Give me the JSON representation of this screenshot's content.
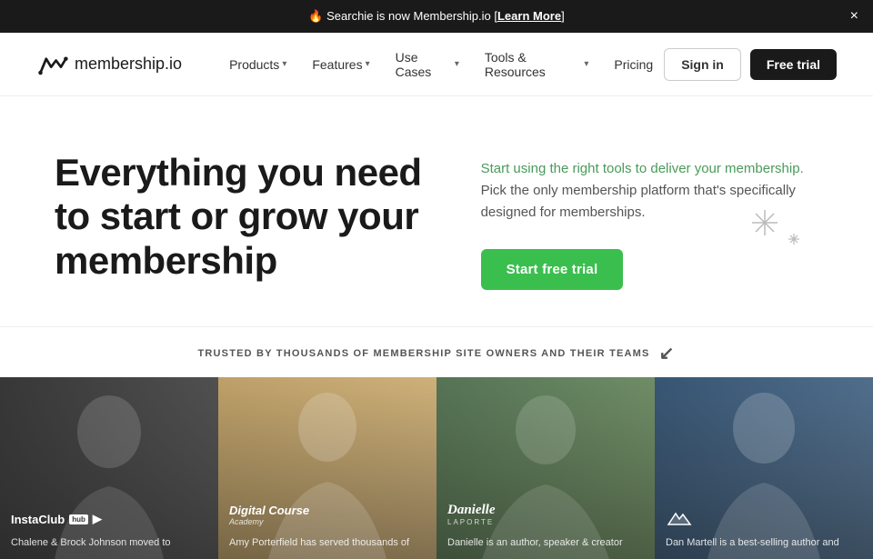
{
  "banner": {
    "text": "🔥 Searchie is now Membership.io [",
    "link_text": "Learn More",
    "text_end": "]",
    "close_label": "×"
  },
  "nav": {
    "logo_text": "membership",
    "logo_suffix": ".io",
    "items": [
      {
        "label": "Products",
        "has_dropdown": true
      },
      {
        "label": "Features",
        "has_dropdown": true
      },
      {
        "label": "Use Cases",
        "has_dropdown": true
      },
      {
        "label": "Tools & Resources",
        "has_dropdown": true
      },
      {
        "label": "Pricing",
        "has_dropdown": false
      }
    ],
    "signin_label": "Sign in",
    "freetrial_label": "Free trial"
  },
  "hero": {
    "title": "Everything you need to start or grow your membership",
    "description_part1": "Start using the right tools to deliver your membership.",
    "description_part2": " Pick the only membership platform that's specifically designed for memberships.",
    "cta_label": "Start free trial"
  },
  "trusted": {
    "text": "TRUSTED BY THOUSANDS OF MEMBERSHIP SITE OWNERS AND THEIR TEAMS"
  },
  "testimonials": [
    {
      "name": "InstaClub Hub",
      "caption": "Chalene & Brock Johnson moved to",
      "bg_color": "#3a3a3a",
      "logo_icon": "▶"
    },
    {
      "name": "Digital Course Academy",
      "caption": "Amy Porterfield has served thousands of",
      "bg_color": "#c8a070",
      "logo_icon": ""
    },
    {
      "name": "Danielle LaPorte",
      "caption": "Danielle is an author, speaker & creator",
      "bg_color": "#5a7a5a",
      "logo_icon": ""
    },
    {
      "name": "Dan Martell",
      "caption": "Dan Martell is a best-selling author and",
      "bg_color": "#4a6a8a",
      "logo_icon": "▲"
    }
  ]
}
